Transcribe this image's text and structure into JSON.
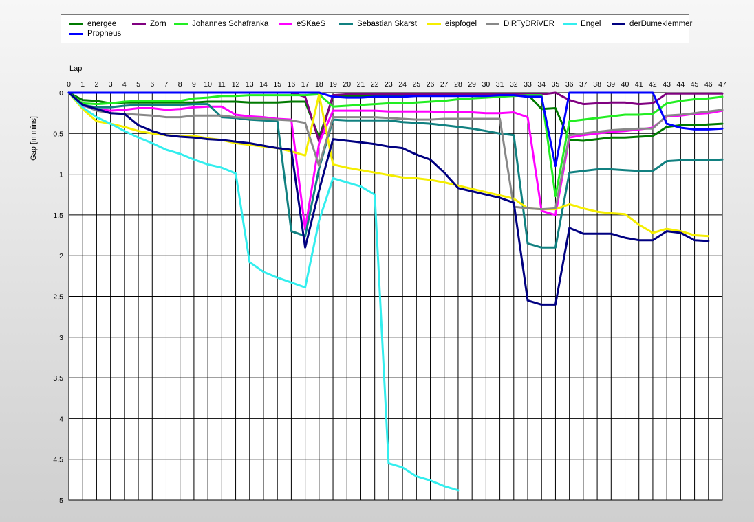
{
  "chart_data": {
    "type": "line",
    "xlabel": "Lap",
    "ylabel": "Gap [in mins]",
    "xlim": [
      0,
      47
    ],
    "ylim": [
      0,
      5
    ],
    "y_inverted": true,
    "grid": true,
    "legend_position": "top",
    "xticks": [
      0,
      1,
      2,
      3,
      4,
      5,
      6,
      7,
      8,
      9,
      10,
      11,
      12,
      13,
      14,
      15,
      16,
      17,
      18,
      19,
      20,
      21,
      22,
      23,
      24,
      25,
      26,
      27,
      28,
      29,
      30,
      31,
      32,
      33,
      34,
      35,
      36,
      37,
      38,
      39,
      40,
      41,
      42,
      43,
      44,
      45,
      46,
      47
    ],
    "yticks": [
      0,
      0.5,
      1,
      1.5,
      2,
      2.5,
      3,
      3.5,
      4,
      4.5,
      5
    ],
    "ytick_labels": [
      "0",
      "0,5",
      "1",
      "1,5",
      "2",
      "2,5",
      "3",
      "3,5",
      "4",
      "4,5",
      "5"
    ],
    "series": [
      {
        "name": "energee",
        "color": "#007a00",
        "values": [
          0,
          0.09,
          0.1,
          0.13,
          0.12,
          0.12,
          0.12,
          0.12,
          0.12,
          0.12,
          0.11,
          0.11,
          0.11,
          0.12,
          0.12,
          0.12,
          0.11,
          0.11,
          0.55,
          0.05,
          0.04,
          0.04,
          0.04,
          0.04,
          0.04,
          0.03,
          0.03,
          0.03,
          0.03,
          0.03,
          0.03,
          0.02,
          0.02,
          0.02,
          0.2,
          0.19,
          0.58,
          0.59,
          0.57,
          0.55,
          0.55,
          0.54,
          0.53,
          0.42,
          0.4,
          0.4,
          0.39,
          0.38
        ]
      },
      {
        "name": "Zorn",
        "color": "#800080",
        "values": [
          0,
          0,
          0,
          0,
          0,
          0,
          0,
          0,
          0,
          0,
          0,
          0,
          0,
          0,
          0,
          0,
          0,
          0.05,
          0.6,
          0.03,
          0.02,
          0.02,
          0.02,
          0.02,
          0.02,
          0.02,
          0.02,
          0.02,
          0.02,
          0.02,
          0.02,
          0.02,
          0.02,
          0.02,
          0.02,
          0,
          0.09,
          0.14,
          0.13,
          0.12,
          0.12,
          0.14,
          0.13,
          0.01,
          0.01,
          0.01,
          0.01,
          0.01
        ]
      },
      {
        "name": "Johannes Schafranka",
        "color": "#22ee22",
        "values": [
          0,
          0.13,
          0.14,
          0.13,
          0.11,
          0.1,
          0.1,
          0.1,
          0.1,
          0.07,
          0.06,
          0.04,
          0.04,
          0.03,
          0.03,
          0.03,
          0.03,
          0.03,
          0.02,
          0.17,
          0.16,
          0.15,
          0.14,
          0.13,
          0.13,
          0.12,
          0.11,
          0.1,
          0.08,
          0.07,
          0.06,
          0.05,
          0.04,
          0.03,
          0.03,
          1.27,
          0.35,
          0.33,
          0.31,
          0.29,
          0.27,
          0.27,
          0.26,
          0.13,
          0.1,
          0.08,
          0.07,
          0.05
        ]
      },
      {
        "name": "eSKaeS",
        "color": "#ff00ff",
        "values": [
          0,
          0.16,
          0.2,
          0.22,
          0.21,
          0.19,
          0.19,
          0.21,
          0.2,
          0.18,
          0.17,
          0.17,
          0.27,
          0.29,
          0.3,
          0.32,
          0.33,
          1.68,
          0.62,
          0.22,
          0.22,
          0.22,
          0.22,
          0.23,
          0.23,
          0.23,
          0.23,
          0.24,
          0.24,
          0.24,
          0.25,
          0.25,
          0.24,
          0.3,
          1.45,
          1.5,
          0.55,
          0.52,
          0.5,
          0.48,
          0.47,
          0.45,
          0.43,
          0.29,
          0.28,
          0.26,
          0.25,
          0.22
        ]
      },
      {
        "name": "Sebastian Skarst",
        "color": "#118080",
        "values": [
          0,
          0.15,
          0.18,
          0.18,
          0.16,
          0.15,
          0.15,
          0.15,
          0.15,
          0.14,
          0.14,
          0.3,
          0.31,
          0.33,
          0.34,
          0.35,
          1.7,
          1.76,
          0.93,
          0.33,
          0.34,
          0.34,
          0.34,
          0.34,
          0.36,
          0.37,
          0.38,
          0.4,
          0.42,
          0.44,
          0.47,
          0.5,
          0.52,
          1.85,
          1.9,
          1.9,
          0.98,
          0.96,
          0.94,
          0.94,
          0.95,
          0.96,
          0.96,
          0.84,
          0.83,
          0.83,
          0.83,
          0.82
        ]
      },
      {
        "name": "eispfogel",
        "color": "#f5ee00",
        "values": [
          0,
          0.2,
          0.35,
          0.38,
          0.42,
          0.47,
          0.5,
          0.52,
          0.53,
          0.53,
          0.56,
          0.58,
          0.62,
          0.64,
          0.66,
          0.68,
          0.72,
          0.77,
          0.02,
          0.88,
          0.92,
          0.95,
          0.98,
          1.01,
          1.04,
          1.05,
          1.07,
          1.1,
          1.14,
          1.18,
          1.22,
          1.26,
          1.3,
          1.42,
          1.43,
          1.43,
          1.37,
          1.42,
          1.46,
          1.48,
          1.49,
          1.62,
          1.72,
          1.67,
          1.7,
          1.75,
          1.76
        ]
      },
      {
        "name": "DiRTyDRiVER",
        "color": "#888888",
        "values": [
          0,
          0.15,
          0.22,
          0.25,
          0.26,
          0.27,
          0.28,
          0.3,
          0.3,
          0.28,
          0.28,
          0.28,
          0.3,
          0.31,
          0.32,
          0.33,
          0.34,
          0.37,
          0.9,
          0.3,
          0.3,
          0.3,
          0.3,
          0.31,
          0.32,
          0.33,
          0.33,
          0.32,
          0.32,
          0.32,
          0.32,
          0.32,
          1.4,
          1.42,
          1.43,
          1.42,
          0.52,
          0.5,
          0.48,
          0.46,
          0.45,
          0.44,
          0.44,
          0.28,
          0.27,
          0.25,
          0.23,
          0.21
        ]
      },
      {
        "name": "Engel",
        "color": "#33eeee",
        "values": [
          0,
          0.18,
          0.3,
          0.38,
          0.47,
          0.55,
          0.62,
          0.7,
          0.75,
          0.82,
          0.88,
          0.92,
          0.99,
          2.08,
          2.2,
          2.27,
          2.33,
          2.39,
          1.57,
          1.05,
          1.1,
          1.15,
          1.25,
          4.55,
          4.6,
          4.71,
          4.76,
          4.83,
          4.88
        ]
      },
      {
        "name": "derDumeklemmer",
        "color": "#000080",
        "values": [
          0,
          0.15,
          0.2,
          0.25,
          0.26,
          0.4,
          0.47,
          0.52,
          0.54,
          0.55,
          0.57,
          0.58,
          0.6,
          0.62,
          0.65,
          0.68,
          0.7,
          1.9,
          1.2,
          0.57,
          0.59,
          0.61,
          0.63,
          0.66,
          0.68,
          0.76,
          0.82,
          0.98,
          1.17,
          1.21,
          1.25,
          1.29,
          1.35,
          2.55,
          2.6,
          2.6,
          1.66,
          1.73,
          1.73,
          1.73,
          1.78,
          1.81,
          1.81,
          1.7,
          1.72,
          1.81,
          1.82
        ]
      },
      {
        "name": "Propheus",
        "color": "#0000ff",
        "values": [
          0,
          0,
          0,
          0,
          0,
          0,
          0,
          0,
          0,
          0,
          0,
          0,
          0,
          0,
          0,
          0,
          0,
          0,
          0,
          0.05,
          0.06,
          0.06,
          0.05,
          0.05,
          0.05,
          0.04,
          0.04,
          0.04,
          0.04,
          0.04,
          0.04,
          0.03,
          0.03,
          0.05,
          0.05,
          0.9,
          0,
          0,
          0,
          0,
          0,
          0,
          0,
          0.38,
          0.43,
          0.45,
          0.45,
          0.44
        ]
      }
    ]
  }
}
